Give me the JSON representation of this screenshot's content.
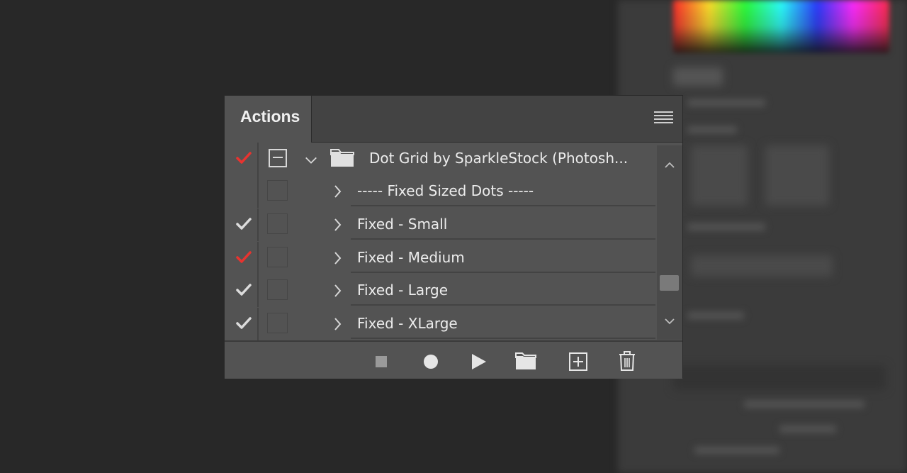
{
  "panel": {
    "tab_label": "Actions",
    "menu_icon": "panel-menu-icon"
  },
  "action_set": {
    "label": "Dot Grid by SparkleStock (Photosh...",
    "checked": true,
    "check_color": "#e8332f",
    "icons": [
      "dialog-toggle-icon",
      "chevron-down-icon",
      "folder-icon"
    ]
  },
  "actions": [
    {
      "label": "----- Fixed Sized Dots -----",
      "checked": false,
      "check_color": ""
    },
    {
      "label": "Fixed - Small",
      "checked": true,
      "check_color": "#dcdcdc"
    },
    {
      "label": "Fixed - Medium",
      "checked": true,
      "check_color": "#e8332f"
    },
    {
      "label": "Fixed - Large",
      "checked": true,
      "check_color": "#dcdcdc"
    },
    {
      "label": "Fixed - XLarge",
      "checked": true,
      "check_color": "#dcdcdc"
    }
  ],
  "footer_icons": [
    "stop-icon",
    "record-icon",
    "play-icon",
    "new-set-folder-icon",
    "new-action-icon",
    "trash-icon"
  ]
}
